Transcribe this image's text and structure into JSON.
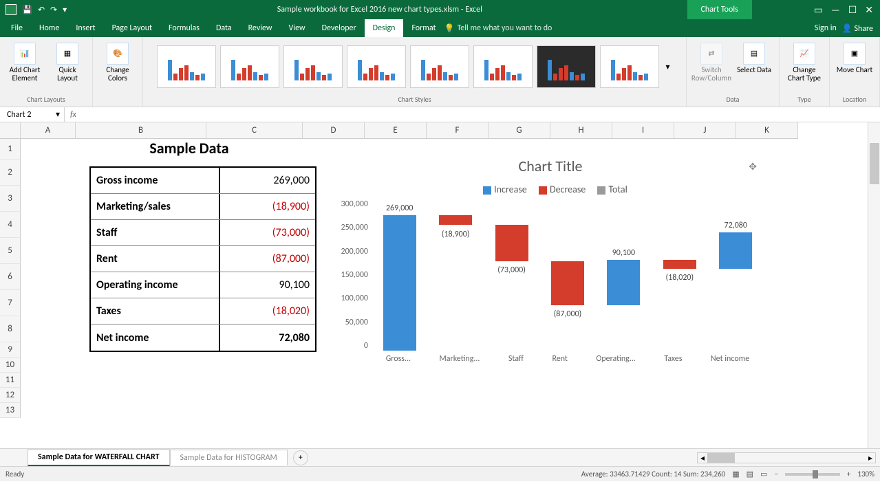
{
  "titlebar": {
    "doc_title": "Sample workbook for Excel 2016 new chart types.xlsm - Excel",
    "chart_tools": "Chart Tools"
  },
  "ribbon": {
    "tabs": [
      "File",
      "Home",
      "Insert",
      "Page Layout",
      "Formulas",
      "Data",
      "Review",
      "View",
      "Developer",
      "Design",
      "Format"
    ],
    "active_tab": "Design",
    "tellme": "Tell me what you want to do",
    "signin": "Sign in",
    "share": "Share",
    "groups": {
      "chart_layouts": {
        "label": "Chart Layouts",
        "add_element": "Add Chart Element",
        "quick_layout": "Quick Layout"
      },
      "change_colors": "Change Colors",
      "chart_styles": "Chart Styles",
      "data": {
        "label": "Data",
        "switch": "Switch Row/Column",
        "select": "Select Data"
      },
      "type": {
        "label": "Type",
        "change_type": "Change Chart Type"
      },
      "location": {
        "label": "Location",
        "move_chart": "Move Chart"
      }
    }
  },
  "namebox": {
    "name": "Chart 2",
    "fx": "fx"
  },
  "columns": [
    "A",
    "B",
    "C",
    "D",
    "E",
    "F",
    "G",
    "H",
    "I",
    "J",
    "K"
  ],
  "rows": [
    "1",
    "2",
    "3",
    "4",
    "5",
    "6",
    "7",
    "8",
    "9",
    "10",
    "11",
    "12",
    "13"
  ],
  "table": {
    "title": "Sample Data",
    "rows": [
      {
        "label": "Gross income",
        "value": "269,000",
        "neg": false,
        "bold": false
      },
      {
        "label": "Marketing/sales",
        "value": "(18,900)",
        "neg": true,
        "bold": false
      },
      {
        "label": "Staff",
        "value": "(73,000)",
        "neg": true,
        "bold": false
      },
      {
        "label": "Rent",
        "value": "(87,000)",
        "neg": true,
        "bold": false
      },
      {
        "label": "Operating income",
        "value": "90,100",
        "neg": false,
        "bold": false
      },
      {
        "label": "Taxes",
        "value": "(18,020)",
        "neg": true,
        "bold": false
      },
      {
        "label": "Net income",
        "value": "72,080",
        "neg": false,
        "bold": true
      }
    ]
  },
  "chart": {
    "title": "Chart Title",
    "legend": {
      "increase": "Increase",
      "decrease": "Decrease",
      "total": "Total"
    },
    "y_ticks": [
      "300,000",
      "250,000",
      "200,000",
      "150,000",
      "100,000",
      "50,000",
      "0"
    ],
    "x_labels": [
      "Gross...",
      "Marketing...",
      "Staff",
      "Rent",
      "Operating...",
      "Taxes",
      "Net income"
    ],
    "data_labels": [
      "269,000",
      "(18,900)",
      "(73,000)",
      "(87,000)",
      "90,100",
      "(18,020)",
      "72,080"
    ]
  },
  "chart_data": {
    "type": "waterfall",
    "title": "Chart Title",
    "categories": [
      "Gross income",
      "Marketing/sales",
      "Staff",
      "Rent",
      "Operating income",
      "Taxes",
      "Net income"
    ],
    "values": [
      269000,
      -18900,
      -73000,
      -87000,
      90100,
      -18020,
      72080
    ],
    "legend": [
      "Increase",
      "Decrease",
      "Total"
    ],
    "ylim": [
      0,
      300000
    ],
    "y_ticks": [
      0,
      50000,
      100000,
      150000,
      200000,
      250000,
      300000
    ]
  },
  "sheets": {
    "active": "Sample Data for WATERFALL CHART",
    "other": "Sample Data for HISTOGRAM"
  },
  "status": {
    "ready": "Ready",
    "summary": "Average: 33463.71429   Count: 14   Sum: 234,260",
    "zoom": "130%"
  }
}
